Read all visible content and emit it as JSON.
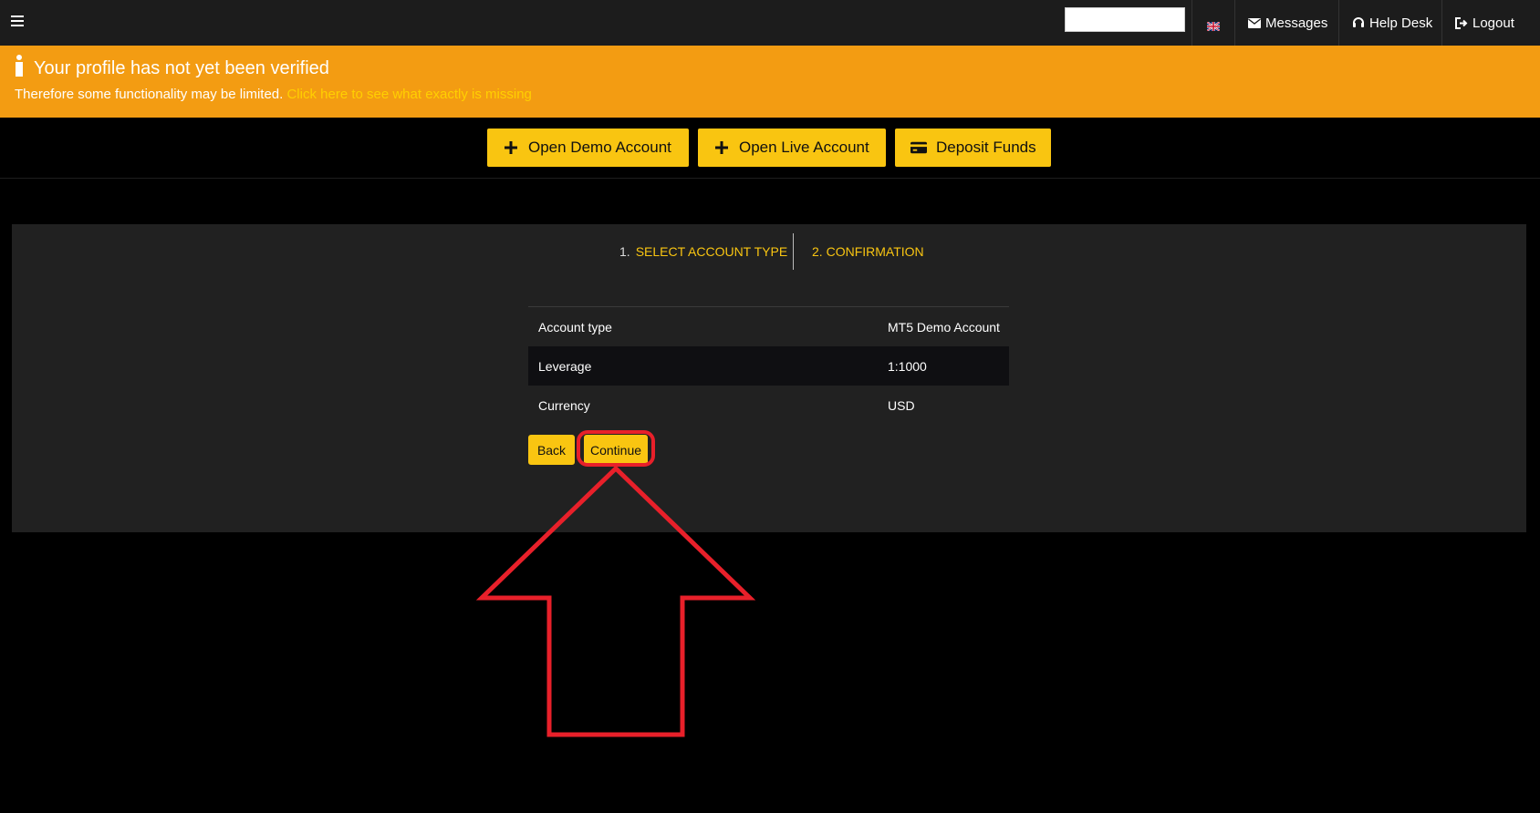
{
  "topbar": {
    "messages_label": "Messages",
    "helpdesk_label": "Help Desk",
    "logout_label": "Logout",
    "search_value": ""
  },
  "alert": {
    "title": "Your profile has not yet been verified",
    "text": "Therefore some functionality may be limited.",
    "link": "Click here to see what exactly is missing"
  },
  "actions": {
    "open_demo": "Open Demo Account",
    "open_live": "Open Live Account",
    "deposit": "Deposit Funds"
  },
  "steps": [
    {
      "num": "1.",
      "label": "SELECT ACCOUNT TYPE"
    },
    {
      "num": "2.",
      "label": "CONFIRMATION"
    }
  ],
  "summary": [
    {
      "key": "Account type",
      "value": "MT5 Demo Account"
    },
    {
      "key": "Leverage",
      "value": "1:1000"
    },
    {
      "key": "Currency",
      "value": "USD"
    }
  ],
  "buttons": {
    "back": "Back",
    "continue": "Continue"
  },
  "colors": {
    "accent": "#f9c511",
    "alert_bg": "#f39c12",
    "highlight": "#e8202a"
  }
}
